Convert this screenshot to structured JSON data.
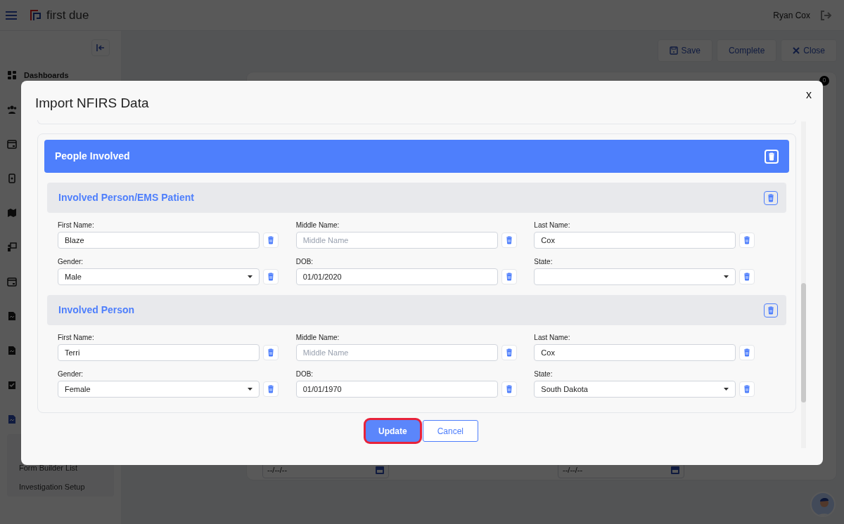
{
  "app": {
    "brand": "first due",
    "user": "Ryan Cox",
    "actions": [
      {
        "kind": "save",
        "label": "Save"
      },
      {
        "kind": "plain",
        "label": "Complete"
      },
      {
        "kind": "close",
        "label": "Close"
      }
    ],
    "sidebar": {
      "items": [
        {
          "kind": "grid",
          "label": "Dashboards",
          "selected": false
        },
        {
          "kind": "people",
          "selected": false
        },
        {
          "kind": "calendar",
          "selected": false
        },
        {
          "kind": "device",
          "selected": false
        },
        {
          "kind": "map",
          "selected": false
        },
        {
          "kind": "board",
          "selected": false
        },
        {
          "kind": "calendar",
          "selected": false
        },
        {
          "kind": "doc",
          "selected": false
        },
        {
          "kind": "doc",
          "selected": false
        },
        {
          "kind": "check",
          "selected": false
        },
        {
          "kind": "doc",
          "selected": true
        }
      ],
      "subitems": [
        {
          "label": "Form Builder List"
        },
        {
          "label": "Investigation Setup"
        }
      ]
    },
    "badge": "0",
    "date_fields": [
      {
        "placeholder": "--/--/--"
      },
      {
        "placeholder": "--/--/--"
      }
    ]
  },
  "modal": {
    "title": "Import NFIRS Data",
    "close": "x",
    "section": {
      "title": "People Involved",
      "people": [
        {
          "title": "Involved Person/EMS Patient",
          "fields": [
            {
              "label": "First Name:",
              "kind": "text",
              "value": "Blaze"
            },
            {
              "label": "Middle Name:",
              "kind": "text",
              "placeholder": "Middle Name"
            },
            {
              "label": "Last Name:",
              "kind": "text",
              "value": "Cox"
            },
            {
              "label": "Gender:",
              "kind": "select",
              "value": "Male"
            },
            {
              "label": "DOB:",
              "kind": "text",
              "value": "01/01/2020"
            },
            {
              "label": "State:",
              "kind": "select"
            }
          ]
        },
        {
          "title": "Involved Person",
          "fields": [
            {
              "label": "First Name:",
              "kind": "text",
              "value": "Terri"
            },
            {
              "label": "Middle Name:",
              "kind": "text",
              "placeholder": "Middle Name"
            },
            {
              "label": "Last Name:",
              "kind": "text",
              "value": "Cox"
            },
            {
              "label": "Gender:",
              "kind": "select",
              "value": "Female"
            },
            {
              "label": "DOB:",
              "kind": "text",
              "value": "01/01/1970"
            },
            {
              "label": "State:",
              "kind": "select",
              "value": "South Dakota"
            }
          ]
        }
      ]
    },
    "buttons": [
      {
        "kind": "primary",
        "label": "Update",
        "focused": true
      },
      {
        "kind": "secondary",
        "label": "Cancel",
        "focused": false
      }
    ]
  }
}
